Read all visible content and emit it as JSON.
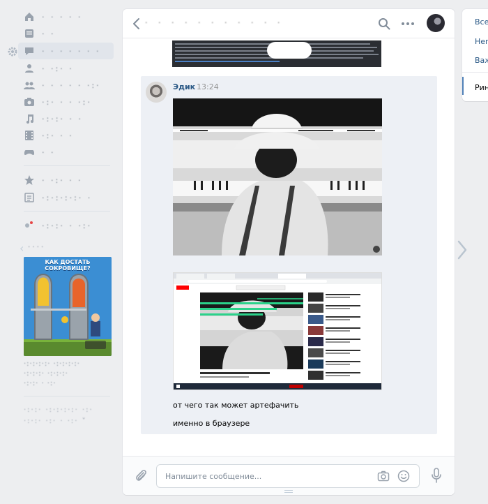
{
  "sidebar": {
    "items": [
      {
        "icon": "home-icon",
        "label": "· · · · ·",
        "active": false
      },
      {
        "icon": "news-icon",
        "label": "· ·",
        "active": false
      },
      {
        "icon": "messages-icon",
        "label": "· · · · · · ·",
        "active": true
      },
      {
        "icon": "friends-icon",
        "label": "· ·:· ·",
        "active": false
      },
      {
        "icon": "communities-icon",
        "label": "· · · · · ·:·",
        "active": false
      },
      {
        "icon": "photos-icon",
        "label": "·:· · · ·:·",
        "active": false
      },
      {
        "icon": "music-icon",
        "label": "·:·:· · ·",
        "active": false
      },
      {
        "icon": "videos-icon",
        "label": "·:· · ·",
        "active": false
      },
      {
        "icon": "games-icon",
        "label": "· ·",
        "active": false
      },
      {
        "icon": "bookmarks-icon",
        "label": "· ·:· · ·",
        "active": false
      },
      {
        "icon": "documents-icon",
        "label": "·:·:·:·:· ·",
        "active": false
      },
      {
        "icon": "apps-icon",
        "label": "·:·:· · ·:·",
        "active": false
      }
    ],
    "ad_label": "· · · ·",
    "ad_image_text": "КАК ДОСТАТЬ СОКРОВИЩЕ?",
    "ad_caption_1": "·:·:·:·:· ·:·:·:·:·",
    "ad_caption_2": "·:·:·:· ·:·:·:·",
    "ad_caption_3": "·:·:· · ·:·",
    "footer_1": "·:·:· ·:·:·:·:· ·:·",
    "footer_2": "·:·:· ·:· · ·:· ˅"
  },
  "chat": {
    "title": "· · · · · · · · · · ·",
    "message": {
      "author": "Эдик",
      "time": "13:24",
      "text_1": "от чего так может артефачить",
      "text_2": "именно в браузере"
    },
    "input_placeholder": "Напишите сообщение..."
  },
  "folders": {
    "items": [
      {
        "label": "Все",
        "active": false
      },
      {
        "label": "Непрочитанные",
        "active": false
      },
      {
        "label": "Важные",
        "active": false
      },
      {
        "label": "Ринат",
        "active": true
      }
    ]
  }
}
